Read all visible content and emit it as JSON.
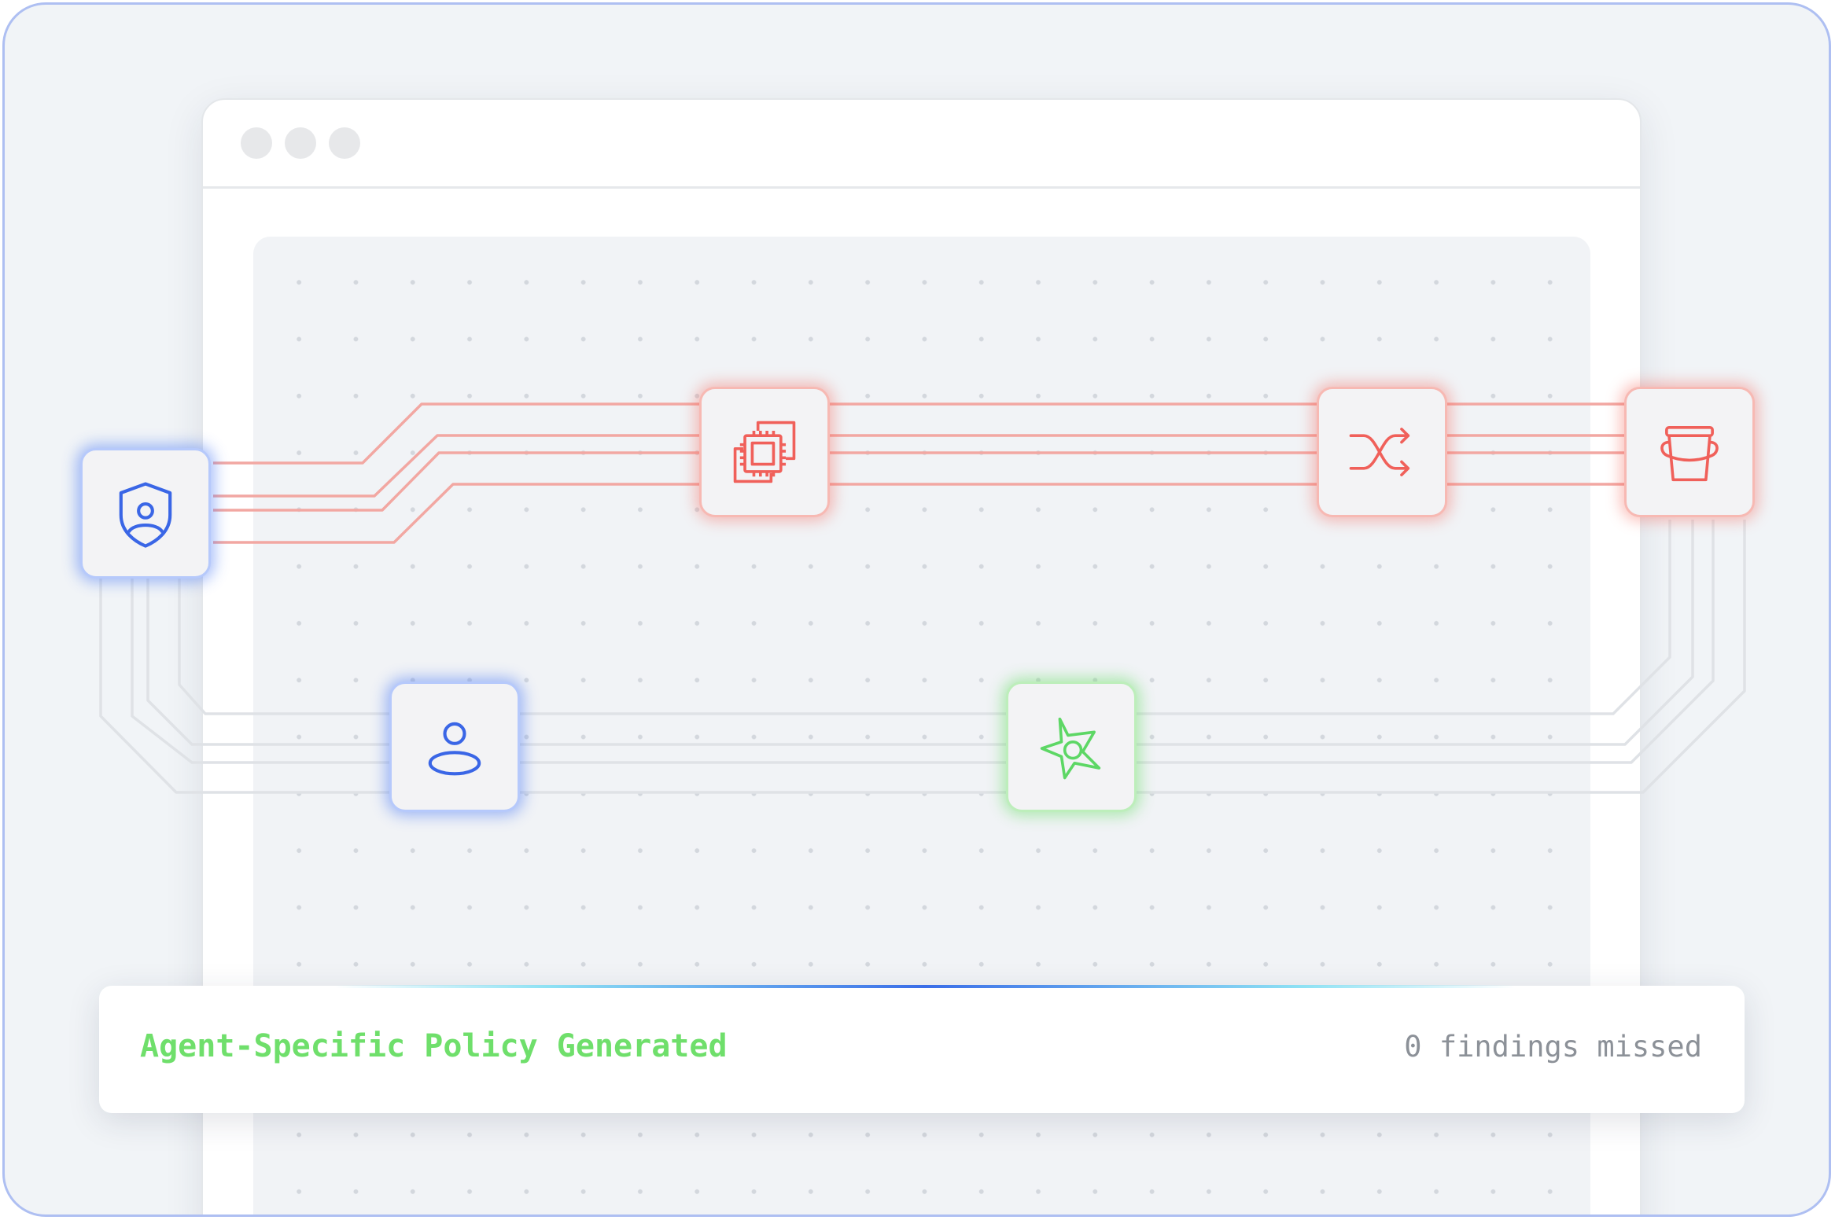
{
  "diagram": {
    "nodes": [
      {
        "id": "identity-policy",
        "icon": "shield-user-icon",
        "status": "blue"
      },
      {
        "id": "compute",
        "icon": "chip-icon",
        "status": "red"
      },
      {
        "id": "router",
        "icon": "shuffle-icon",
        "status": "red"
      },
      {
        "id": "storage",
        "icon": "bucket-icon",
        "status": "red"
      },
      {
        "id": "user",
        "icon": "user-icon",
        "status": "blue"
      },
      {
        "id": "agent",
        "icon": "shuriken-icon",
        "status": "green"
      }
    ],
    "colors": {
      "red": "#f0605a",
      "blue": "#3a66e6",
      "green": "#5dd765",
      "red_wire": "#f2a7a2",
      "gray_wire": "#dfe2e6"
    }
  },
  "status_bar": {
    "title": "Agent-Specific Policy Generated",
    "meta": "0 findings missed"
  }
}
